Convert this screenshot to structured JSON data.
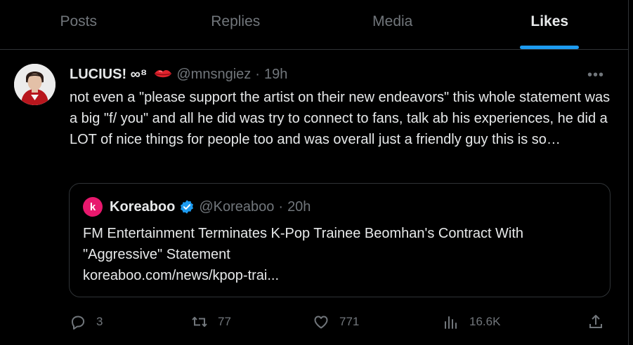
{
  "tabs": [
    {
      "label": "Posts",
      "active": false
    },
    {
      "label": "Replies",
      "active": false
    },
    {
      "label": "Media",
      "active": false
    },
    {
      "label": "Likes",
      "active": true
    }
  ],
  "tweet": {
    "display_name": "LUCIUS! ∞⁸",
    "handle": "@mnsngiez",
    "separator": "·",
    "time": "19h",
    "more_label": "•••",
    "text": "not even a \"please support the artist on their new endeavors\" this whole statement was a big \"f/ you\" and all he did was try to connect to fans, talk ab his experiences, he did a LOT of nice things for people too and was overall just a friendly guy this is so…",
    "quote": {
      "avatar_letter": "k",
      "name": "Koreaboo",
      "handle": "@Koreaboo",
      "separator": "·",
      "time": "20h",
      "text": "FM Entertainment Terminates K-Pop Trainee Beomhan's Contract With \"Aggressive\" Statement",
      "link": "koreaboo.com/news/kpop-trai..."
    },
    "actions": {
      "replies": "3",
      "reposts": "77",
      "likes": "771",
      "views": "16.6K"
    }
  },
  "colors": {
    "background": "#000000",
    "text": "#e7e9ea",
    "muted": "#71767b",
    "border": "#2f3336",
    "accent": "#1d9bf0",
    "verified": "#1d9bf0",
    "koreaboo": "#e8186d"
  },
  "icons": {
    "reply": "speech-bubble-icon",
    "repost": "repost-arrows-icon",
    "like": "heart-icon",
    "views": "bar-chart-icon",
    "share": "share-upload-icon",
    "lips": "kiss-lips-emoji",
    "verified": "verified-badge-icon"
  }
}
